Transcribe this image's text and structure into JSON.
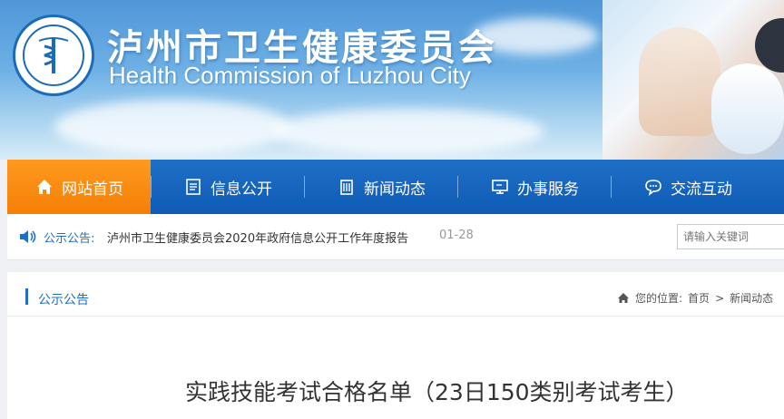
{
  "header": {
    "title_cn": "泸州市卫生健康委员会",
    "title_en": "Health Commission of Luzhou City",
    "logo_text": "Health Commission of Luzhou City"
  },
  "nav": {
    "items": [
      {
        "label": "网站首页",
        "icon": "home-icon",
        "active": true
      },
      {
        "label": "信息公开",
        "icon": "document-icon",
        "active": false
      },
      {
        "label": "新闻动态",
        "icon": "building-icon",
        "active": false
      },
      {
        "label": "办事服务",
        "icon": "monitor-icon",
        "active": false
      },
      {
        "label": "交流互动",
        "icon": "chat-icon",
        "active": false
      }
    ]
  },
  "notice": {
    "label": "公示公告:",
    "text": "泸州市卫生健康委员会2020年政府信息公开工作年度报告",
    "date": "01-28"
  },
  "search": {
    "placeholder": "请输入关键词"
  },
  "section": {
    "title": "公示公告",
    "breadcrumb_prefix": "您的位置:",
    "breadcrumb": [
      "首页",
      ">",
      "新闻动态"
    ]
  },
  "article": {
    "title": "实践技能考试合格名单（23日150类别考试考生）"
  },
  "colors": {
    "nav_blue": "#1f6fc7",
    "nav_active": "#f57f06",
    "banner_top": "#4f97d8"
  }
}
